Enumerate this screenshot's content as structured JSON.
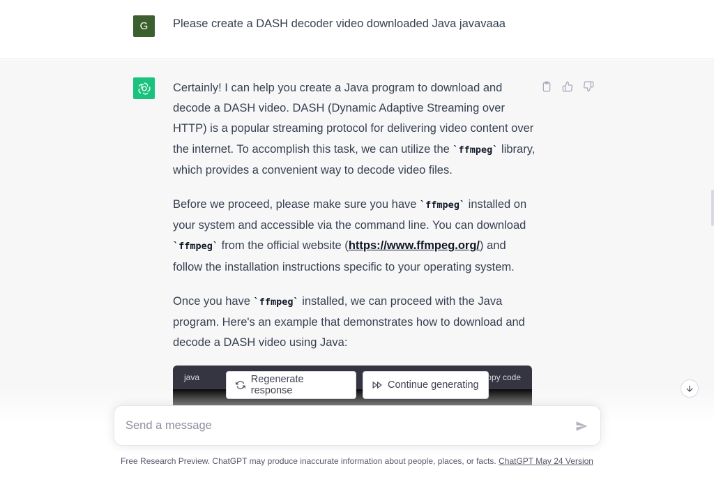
{
  "user_message": {
    "avatar_letter": "G",
    "text": "Please create a DASH decoder video downloaded Java javavaaa"
  },
  "assistant": {
    "avatar_icon": "openai-logo-icon",
    "p1_a": "Certainly! I can help you create a Java program to download and decode a DASH video. DASH (Dynamic Adaptive Streaming over HTTP) is a popular streaming protocol for delivering video content over the internet. To accomplish this task, we can utilize the ",
    "p1_code": "`ffmpeg`",
    "p1_b": " library, which provides a convenient way to decode video files.",
    "p2_a": "Before we proceed, please make sure you have ",
    "p2_code1": "`ffmpeg`",
    "p2_b": " installed on your system and accessible via the command line. You can download ",
    "p2_code2": "`ffmpeg`",
    "p2_c": " from the official website (",
    "p2_link": "https://www.ffmpeg.org/",
    "p2_d": ") and follow the installation instructions specific to your operating system.",
    "p3_a": "Once you have ",
    "p3_code": "`ffmpeg`",
    "p3_b": " installed, we can proceed with the Java program. Here's an example that demonstrates how to download and decode a DASH video using Java:",
    "code_block": {
      "language": "java",
      "copy_label": "Copy code"
    }
  },
  "message_actions": [
    "clipboard-icon",
    "thumbs-up-icon",
    "thumbs-down-icon"
  ],
  "buttons": {
    "regenerate": "Regenerate response",
    "continue": "Continue generating"
  },
  "input": {
    "placeholder": "Send a message"
  },
  "footer": {
    "text": "Free Research Preview. ChatGPT may produce inaccurate information about people, places, or facts. ",
    "link": "ChatGPT May 24 Version"
  },
  "colors": {
    "user_avatar": "#3c5f2e",
    "assistant_avatar": "#19c37d",
    "assistant_bg": "#f7f7f8",
    "code_header_bg": "#343541"
  }
}
